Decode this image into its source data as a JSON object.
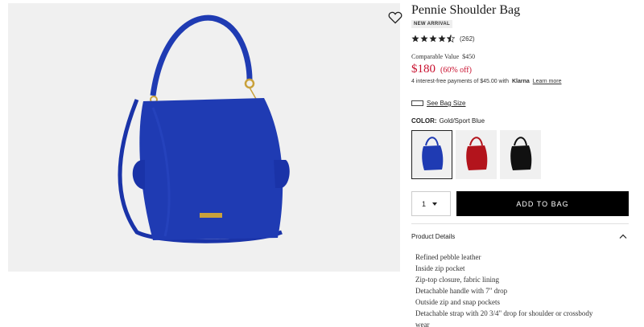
{
  "product": {
    "title": "Pennie Shoulder Bag",
    "badge": "NEW ARRIVAL",
    "rating_value": 4.5,
    "review_count": "(262)",
    "comparable_label": "Comparable Value",
    "comparable_value": "$450",
    "price": "$180",
    "discount": "(60% off)",
    "klarna": {
      "prefix": "4 interest-free payments of $45.00 with",
      "brand": "Klarna",
      "link": "Learn more"
    },
    "bag_size_label": "See Bag Size",
    "color_label": "COLOR:",
    "color_value": "Gold/Sport Blue",
    "swatches": [
      {
        "name": "Gold/Sport Blue",
        "color": "#1f3bb3",
        "selected": true
      },
      {
        "name": "Red",
        "color": "#b3141c",
        "selected": false
      },
      {
        "name": "Black",
        "color": "#111111",
        "selected": false
      }
    ],
    "quantity": "1",
    "add_to_bag": "ADD TO BAG",
    "details_heading": "Product Details",
    "features": [
      "Refined pebble leather",
      "Inside zip pocket",
      "Zip-top closure, fabric lining",
      "Detachable handle with 7\" drop",
      "Outside zip and snap pockets",
      "Detachable strap with 20 3/4\" drop for shoulder or crossbody",
      "wear"
    ]
  },
  "colors": {
    "price_red": "#c8102e",
    "bag_blue": "#1f3bb3",
    "button_black": "#000000"
  },
  "icons": [
    "heart-icon",
    "star-icon",
    "ruler-icon",
    "chevron-down-icon",
    "chevron-up-icon"
  ]
}
